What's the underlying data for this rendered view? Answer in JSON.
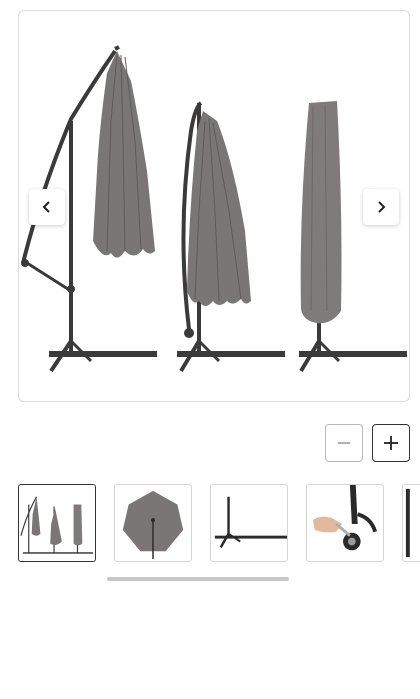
{
  "gallery": {
    "main_image_alt": "",
    "nav": {
      "prev_icon": "chevron-left-icon",
      "next_icon": "chevron-right-icon"
    },
    "zoom": {
      "out_icon": "minus-icon",
      "in_icon": "plus-icon"
    },
    "thumbnails": [
      {
        "name": "thumb-umbrella-variants",
        "active": true
      },
      {
        "name": "thumb-canopy-top-view",
        "active": false
      },
      {
        "name": "thumb-cross-base",
        "active": false
      },
      {
        "name": "thumb-crank-handle",
        "active": false
      },
      {
        "name": "thumb-partial",
        "active": false
      }
    ],
    "colors": {
      "fabric": "#7a7676",
      "pole": "#3a3a3a",
      "border": "#dcdcdc"
    }
  }
}
